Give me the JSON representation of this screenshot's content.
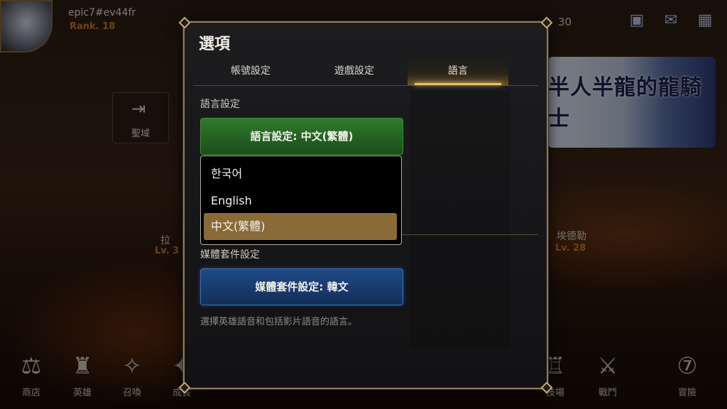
{
  "hud": {
    "player_name": "epic7#ev44fr",
    "player_rank": "Rank. 18",
    "resource_count": "30"
  },
  "background": {
    "map_button_label": "聖域",
    "npc_left_name": "拉",
    "npc_left_level": "Lv. 3",
    "npc_right_name": "埃德勒",
    "npc_right_level": "Lv. 28",
    "banner_title": "半人半龍的龍騎士"
  },
  "bottom_nav": {
    "items": [
      {
        "label": "商店",
        "icon": "scale-icon"
      },
      {
        "label": "英雄",
        "icon": "helmet-icon"
      },
      {
        "label": "召喚",
        "icon": "summon-icon"
      },
      {
        "label": "成長",
        "icon": "growth-icon"
      },
      {
        "label": "技場",
        "icon": "arena-icon"
      },
      {
        "label": "戰鬥",
        "icon": "swords-icon"
      },
      {
        "label": "冒險",
        "icon": "adventure-icon"
      }
    ]
  },
  "dialog": {
    "title": "選項",
    "tabs": [
      {
        "label": "帳號設定",
        "active": false
      },
      {
        "label": "遊戲設定",
        "active": false
      },
      {
        "label": "語言",
        "active": true
      }
    ],
    "language_section_label": "語言設定",
    "language_button": "語言設定: 中文(繁體)",
    "language_options": [
      {
        "label": "한국어",
        "selected": false
      },
      {
        "label": "English",
        "selected": false
      },
      {
        "label": "中文(繁體)",
        "selected": true
      }
    ],
    "media_section_label": "媒體套件設定",
    "media_button": "媒體套件設定: 韓文",
    "description": "選擇英雄語音和包括影片語音的語言。"
  },
  "colors": {
    "accent_gold": "#e6c36a",
    "selected_option": "#8a6a36",
    "green_button": "#2f7a2c",
    "blue_button": "#1f4a86",
    "rank_orange": "#c87a2a"
  }
}
